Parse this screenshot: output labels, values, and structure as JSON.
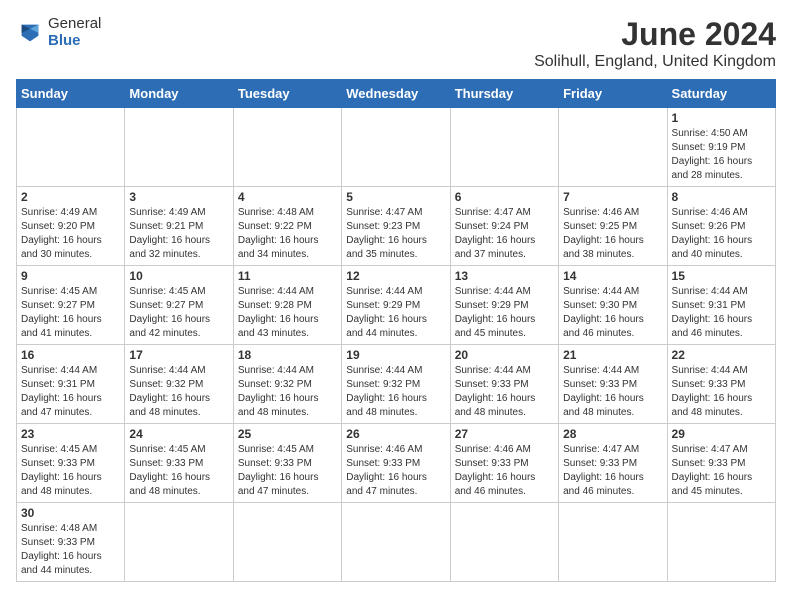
{
  "header": {
    "logo_line1": "General",
    "logo_line2": "Blue",
    "title": "June 2024",
    "subtitle": "Solihull, England, United Kingdom"
  },
  "days_of_week": [
    "Sunday",
    "Monday",
    "Tuesday",
    "Wednesday",
    "Thursday",
    "Friday",
    "Saturday"
  ],
  "weeks": [
    [
      {
        "day": "",
        "info": ""
      },
      {
        "day": "",
        "info": ""
      },
      {
        "day": "",
        "info": ""
      },
      {
        "day": "",
        "info": ""
      },
      {
        "day": "",
        "info": ""
      },
      {
        "day": "",
        "info": ""
      },
      {
        "day": "1",
        "info": "Sunrise: 4:50 AM\nSunset: 9:19 PM\nDaylight: 16 hours\nand 28 minutes."
      }
    ],
    [
      {
        "day": "2",
        "info": "Sunrise: 4:49 AM\nSunset: 9:20 PM\nDaylight: 16 hours\nand 30 minutes."
      },
      {
        "day": "3",
        "info": "Sunrise: 4:49 AM\nSunset: 9:21 PM\nDaylight: 16 hours\nand 32 minutes."
      },
      {
        "day": "4",
        "info": "Sunrise: 4:48 AM\nSunset: 9:22 PM\nDaylight: 16 hours\nand 34 minutes."
      },
      {
        "day": "5",
        "info": "Sunrise: 4:47 AM\nSunset: 9:23 PM\nDaylight: 16 hours\nand 35 minutes."
      },
      {
        "day": "6",
        "info": "Sunrise: 4:47 AM\nSunset: 9:24 PM\nDaylight: 16 hours\nand 37 minutes."
      },
      {
        "day": "7",
        "info": "Sunrise: 4:46 AM\nSunset: 9:25 PM\nDaylight: 16 hours\nand 38 minutes."
      },
      {
        "day": "8",
        "info": "Sunrise: 4:46 AM\nSunset: 9:26 PM\nDaylight: 16 hours\nand 40 minutes."
      }
    ],
    [
      {
        "day": "9",
        "info": "Sunrise: 4:45 AM\nSunset: 9:27 PM\nDaylight: 16 hours\nand 41 minutes."
      },
      {
        "day": "10",
        "info": "Sunrise: 4:45 AM\nSunset: 9:27 PM\nDaylight: 16 hours\nand 42 minutes."
      },
      {
        "day": "11",
        "info": "Sunrise: 4:44 AM\nSunset: 9:28 PM\nDaylight: 16 hours\nand 43 minutes."
      },
      {
        "day": "12",
        "info": "Sunrise: 4:44 AM\nSunset: 9:29 PM\nDaylight: 16 hours\nand 44 minutes."
      },
      {
        "day": "13",
        "info": "Sunrise: 4:44 AM\nSunset: 9:29 PM\nDaylight: 16 hours\nand 45 minutes."
      },
      {
        "day": "14",
        "info": "Sunrise: 4:44 AM\nSunset: 9:30 PM\nDaylight: 16 hours\nand 46 minutes."
      },
      {
        "day": "15",
        "info": "Sunrise: 4:44 AM\nSunset: 9:31 PM\nDaylight: 16 hours\nand 46 minutes."
      }
    ],
    [
      {
        "day": "16",
        "info": "Sunrise: 4:44 AM\nSunset: 9:31 PM\nDaylight: 16 hours\nand 47 minutes."
      },
      {
        "day": "17",
        "info": "Sunrise: 4:44 AM\nSunset: 9:32 PM\nDaylight: 16 hours\nand 48 minutes."
      },
      {
        "day": "18",
        "info": "Sunrise: 4:44 AM\nSunset: 9:32 PM\nDaylight: 16 hours\nand 48 minutes."
      },
      {
        "day": "19",
        "info": "Sunrise: 4:44 AM\nSunset: 9:32 PM\nDaylight: 16 hours\nand 48 minutes."
      },
      {
        "day": "20",
        "info": "Sunrise: 4:44 AM\nSunset: 9:33 PM\nDaylight: 16 hours\nand 48 minutes."
      },
      {
        "day": "21",
        "info": "Sunrise: 4:44 AM\nSunset: 9:33 PM\nDaylight: 16 hours\nand 48 minutes."
      },
      {
        "day": "22",
        "info": "Sunrise: 4:44 AM\nSunset: 9:33 PM\nDaylight: 16 hours\nand 48 minutes."
      }
    ],
    [
      {
        "day": "23",
        "info": "Sunrise: 4:45 AM\nSunset: 9:33 PM\nDaylight: 16 hours\nand 48 minutes."
      },
      {
        "day": "24",
        "info": "Sunrise: 4:45 AM\nSunset: 9:33 PM\nDaylight: 16 hours\nand 48 minutes."
      },
      {
        "day": "25",
        "info": "Sunrise: 4:45 AM\nSunset: 9:33 PM\nDaylight: 16 hours\nand 47 minutes."
      },
      {
        "day": "26",
        "info": "Sunrise: 4:46 AM\nSunset: 9:33 PM\nDaylight: 16 hours\nand 47 minutes."
      },
      {
        "day": "27",
        "info": "Sunrise: 4:46 AM\nSunset: 9:33 PM\nDaylight: 16 hours\nand 46 minutes."
      },
      {
        "day": "28",
        "info": "Sunrise: 4:47 AM\nSunset: 9:33 PM\nDaylight: 16 hours\nand 46 minutes."
      },
      {
        "day": "29",
        "info": "Sunrise: 4:47 AM\nSunset: 9:33 PM\nDaylight: 16 hours\nand 45 minutes."
      }
    ],
    [
      {
        "day": "30",
        "info": "Sunrise: 4:48 AM\nSunset: 9:33 PM\nDaylight: 16 hours\nand 44 minutes."
      },
      {
        "day": "",
        "info": ""
      },
      {
        "day": "",
        "info": ""
      },
      {
        "day": "",
        "info": ""
      },
      {
        "day": "",
        "info": ""
      },
      {
        "day": "",
        "info": ""
      },
      {
        "day": "",
        "info": ""
      }
    ]
  ]
}
